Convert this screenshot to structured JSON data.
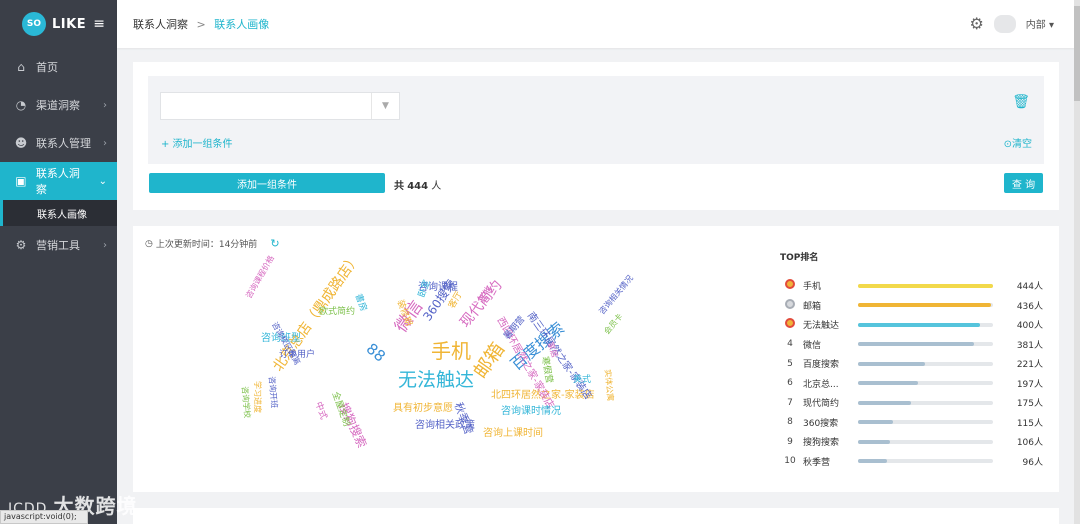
{
  "app": {
    "logo_badge": "SO",
    "logo_text": "LIKE",
    "brand_color": "#1fb5cc"
  },
  "sidebar": {
    "items": [
      {
        "label": "首页",
        "icon": "home-icon"
      },
      {
        "label": "渠道洞察",
        "icon": "pie-chart-icon"
      },
      {
        "label": "联系人管理",
        "icon": "users-icon"
      },
      {
        "label": "联系人洞察",
        "icon": "id-card-icon"
      },
      {
        "label": "营销工具",
        "icon": "cogs-icon"
      }
    ],
    "sub_item": "联系人画像"
  },
  "breadcrumb": {
    "parent": "联系人洞察",
    "separator": ">",
    "current": "联系人画像"
  },
  "user": {
    "name": "内部"
  },
  "filter": {
    "add_condition": "+ 添加一组条件",
    "clear": "清空",
    "add_group_button": "添加一组条件",
    "total_prefix": "共",
    "total_count": "444",
    "total_suffix": "人",
    "query_button": "查 询"
  },
  "insight": {
    "updated_text": "上次更新时间：14分钟前",
    "rank_title": "TOP排名",
    "max": 444,
    "ranking": [
      {
        "rank": "1",
        "name": "手机",
        "count": "444人",
        "value": 444,
        "color": "#f2d94b"
      },
      {
        "rank": "2",
        "name": "邮箱",
        "count": "436人",
        "value": 436,
        "color": "#f0b535"
      },
      {
        "rank": "3",
        "name": "无法触达",
        "count": "400人",
        "value": 400,
        "color": "#55c4dc"
      },
      {
        "rank": "4",
        "name": "微信",
        "count": "381人",
        "value": 381,
        "color": "#a9bfd0"
      },
      {
        "rank": "5",
        "name": "百度搜索",
        "count": "221人",
        "value": 221,
        "color": "#a9bfd0"
      },
      {
        "rank": "6",
        "name": "北京总...",
        "count": "197人",
        "value": 197,
        "color": "#a9bfd0"
      },
      {
        "rank": "7",
        "name": "现代简约",
        "count": "175人",
        "value": 175,
        "color": "#a9bfd0"
      },
      {
        "rank": "8",
        "name": "360搜索",
        "count": "115人",
        "value": 115,
        "color": "#a9bfd0"
      },
      {
        "rank": "9",
        "name": "搜狗搜索",
        "count": "106人",
        "value": 106,
        "color": "#a9bfd0"
      },
      {
        "rank": "10",
        "name": "秋季营",
        "count": "96人",
        "value": 96,
        "color": "#a9bfd0"
      }
    ]
  },
  "wordcloud": [
    {
      "text": "手机",
      "color": "#f0b535"
    },
    {
      "text": "无法触达",
      "color": "#34b6d8"
    },
    {
      "text": "邮箱",
      "color": "#f0b535"
    },
    {
      "text": "微信",
      "color": "#d66ac0"
    },
    {
      "text": "百度搜索",
      "color": "#3a8fd6"
    },
    {
      "text": "北京总店（鼎成路店）",
      "color": "#f0b535"
    },
    {
      "text": "现代简约",
      "color": "#d66ac0"
    },
    {
      "text": "360搜索",
      "color": "#5563c7"
    },
    {
      "text": "搜狗搜索",
      "color": "#d66ac0"
    },
    {
      "text": "秋季营",
      "color": "#5563c7"
    },
    {
      "text": "北四环居然之家-家装店",
      "color": "#f0b535"
    },
    {
      "text": "西四环居然之家-家装店",
      "color": "#d66ac0"
    },
    {
      "text": "南三环居然之家-家装店",
      "color": "#5563c7"
    },
    {
      "text": "咨询课程",
      "color": "#5563c7"
    },
    {
      "text": "咨询班型",
      "color": "#34b6d8"
    },
    {
      "text": "订单用户",
      "color": "#5563c7"
    },
    {
      "text": "欧式简约",
      "color": "#7cc04a"
    },
    {
      "text": "具有初步意愿",
      "color": "#f0b535"
    },
    {
      "text": "咨询课时情况",
      "color": "#34b6d8"
    },
    {
      "text": "咨询相关政策",
      "color": "#5563c7"
    },
    {
      "text": "咨询上课时间",
      "color": "#f0b535"
    },
    {
      "text": "美式",
      "color": "#34b6d8"
    },
    {
      "text": "暑期营",
      "color": "#5563c7"
    },
    {
      "text": "其他",
      "color": "#d66ac0"
    },
    {
      "text": "書房",
      "color": "#34b6d8"
    },
    {
      "text": "中式",
      "color": "#d66ac0"
    },
    {
      "text": "88",
      "color": "#3a8fd6"
    },
    {
      "text": "咨询课程价格",
      "color": "#d66ac0"
    },
    {
      "text": "咨询校区距离",
      "color": "#5563c7"
    },
    {
      "text": "咨询相关情况",
      "color": "#5563c7"
    },
    {
      "text": "实体公寓",
      "color": "#f0b535"
    },
    {
      "text": "会员卡",
      "color": "#7cc04a"
    },
    {
      "text": "装修期",
      "color": "#f0b535"
    },
    {
      "text": "寒假营",
      "color": "#7cc04a"
    },
    {
      "text": "学习进度",
      "color": "#f0b535"
    },
    {
      "text": "全屋定制",
      "color": "#7cc04a"
    },
    {
      "text": "咨询开班",
      "color": "#5563c7"
    },
    {
      "text": "咨询学校",
      "color": "#7cc04a"
    },
    {
      "text": "卧室",
      "color": "#34b6d8"
    },
    {
      "text": "客厅",
      "color": "#f0b535"
    },
    {
      "text": "家居",
      "color": "#d66ac0"
    }
  ],
  "status_bar": {
    "url": "javascript:void(0);"
  },
  "watermark": {
    "logo": "ICDD",
    "text": "大数跨境"
  }
}
